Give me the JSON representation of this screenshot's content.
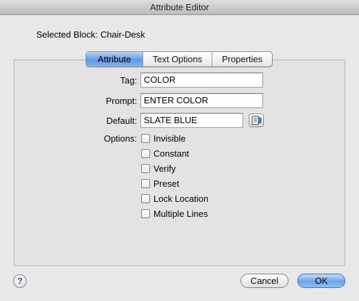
{
  "window": {
    "title": "Attribute Editor"
  },
  "selected_block": {
    "label": "Selected Block:",
    "value": "Chair-Desk"
  },
  "tabs": [
    {
      "label": "Attribute",
      "active": true
    },
    {
      "label": "Text Options",
      "active": false
    },
    {
      "label": "Properties",
      "active": false
    }
  ],
  "fields": {
    "tag": {
      "label": "Tag:",
      "value": "COLOR"
    },
    "prompt": {
      "label": "Prompt:",
      "value": "ENTER COLOR"
    },
    "default": {
      "label": "Default:",
      "value": "SLATE BLUE"
    }
  },
  "options": {
    "label": "Options:",
    "items": [
      {
        "label": "Invisible",
        "checked": false
      },
      {
        "label": "Constant",
        "checked": false
      },
      {
        "label": "Verify",
        "checked": false
      },
      {
        "label": "Preset",
        "checked": false
      },
      {
        "label": "Lock Location",
        "checked": false
      },
      {
        "label": "Multiple Lines",
        "checked": false
      }
    ]
  },
  "buttons": {
    "help": "?",
    "cancel": "Cancel",
    "ok": "OK"
  },
  "icons": {
    "field_picker": "insert-field-icon",
    "help": "help-icon"
  },
  "colors": {
    "accent": "#5e9ae5",
    "help_glyph": "#5b37a8"
  }
}
